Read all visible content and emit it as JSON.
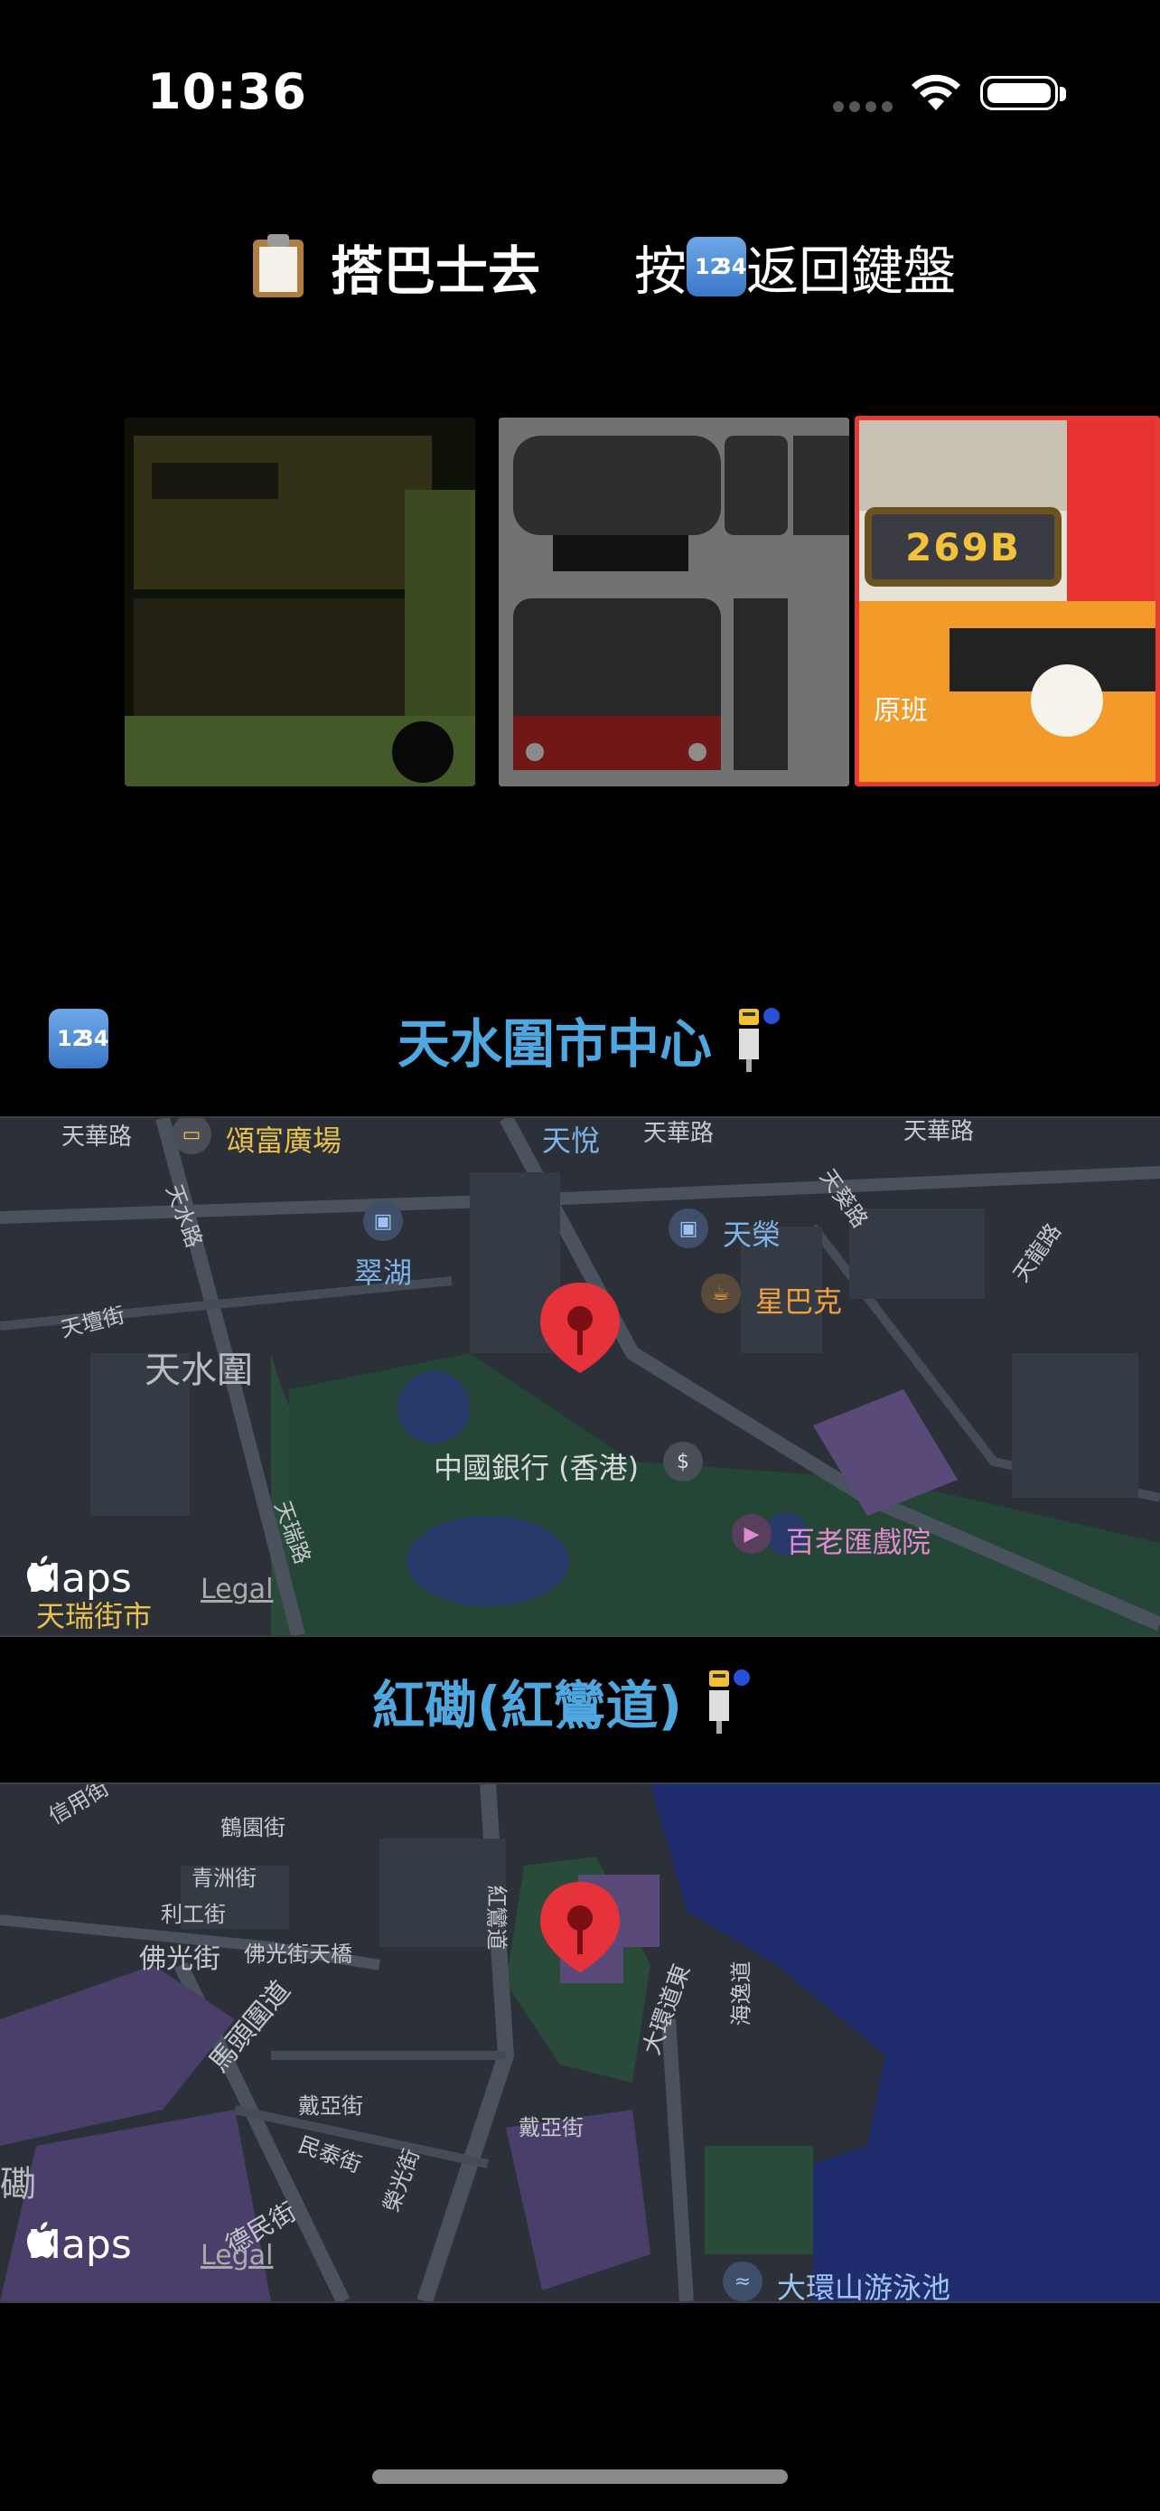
{
  "status_bar": {
    "time": "10:36"
  },
  "header": {
    "title": "搭巴士去",
    "hint_prefix": "按",
    "hint_suffix": "返回鍵盤"
  },
  "key_icon": {
    "top": "12",
    "bottom": "34"
  },
  "bus_cards": [
    {
      "name": "green-double-decker"
    },
    {
      "name": "white-double-decker"
    },
    {
      "route": "269B",
      "caption": "原班",
      "selected": true
    }
  ],
  "stops": [
    {
      "name": "天水圍市中心",
      "map": {
        "labels": {
          "tin_wah_road": "天華路",
          "chung_fu_plaza": "頌富廣場",
          "tin_yuet": "天悅",
          "tin_wah_road2": "天華路",
          "tin_wah_road3": "天華路",
          "tin_shui_road": "天水路",
          "chung_wu": "翠湖",
          "tin_wing": "天榮",
          "tin_tan_st": "天壇街",
          "tin_shui_wai": "天水圍",
          "starbucks": "星巴克",
          "tin_kwai_road": "天葵路",
          "tin_lung_road": "天龍路",
          "boc": "中國銀行 (香港)",
          "cinema": "百老匯戲院",
          "tin_sui_rd": "天瑞路",
          "tin_sui_market": "天瑞街市"
        },
        "maps_brand": "Maps",
        "legal": "Legal"
      }
    },
    {
      "name": "紅磡(紅鸞道)",
      "map": {
        "labels": {
          "shun_on": "信用街",
          "ho_wan": "鶴園街",
          "ching_chau": "青洲街",
          "lee_kung": "利工街",
          "bulkeley": "佛光街",
          "bulkeley_bridge": "佛光街天橋",
          "ma_tau_wai": "馬頭圍道",
          "tai_wan_rd": "大環道東",
          "tak_man": "德民街",
          "tai_a": "戴亞街",
          "tai_a2": "戴亞街",
          "man_tai": "民泰街",
          "hung_luen": "紅鸞道",
          "hung_hom": "磡",
          "wing_kwong": "榮光街",
          "oi_wan": "海逸道",
          "tai_wan_shan_pool": "大環山游泳池"
        },
        "maps_brand": "Maps",
        "legal": "Legal"
      }
    }
  ],
  "colors": {
    "accent_blue": "#4fa7df",
    "selected_border": "#e53b34",
    "pin_red": "#e5323b",
    "route_text": "#f3c13a"
  }
}
